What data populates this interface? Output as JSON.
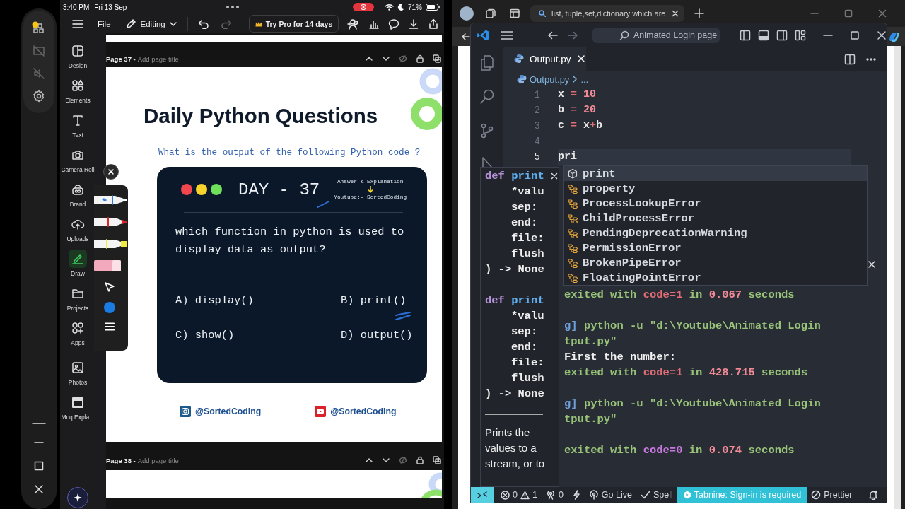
{
  "tablet": {
    "status_bar": {
      "time": "3:40 PM",
      "date": "Fri 13 Sep",
      "battery": "71%"
    },
    "toolbar": {
      "file": "File",
      "mode": "Editing",
      "promo": "Try Pro for 14 days"
    },
    "sidebar": {
      "tools": [
        {
          "label": "Design",
          "selected": false
        },
        {
          "label": "Elements",
          "selected": false
        },
        {
          "label": "Text",
          "selected": false
        },
        {
          "label": "Camera Roll",
          "selected": false
        },
        {
          "label": "Brand",
          "selected": false
        },
        {
          "label": "Uploads",
          "selected": false
        },
        {
          "label": "Draw",
          "selected": true
        },
        {
          "label": "Projects",
          "selected": false
        },
        {
          "label": "Apps",
          "selected": false
        }
      ],
      "folders": [
        {
          "label": "Photos",
          "selected": false
        },
        {
          "label": "Mcq Expla...",
          "selected": false
        }
      ]
    },
    "pages": [
      {
        "number": "Page 37 -",
        "title_placeholder": "Add page title"
      },
      {
        "number": "Page 38 -",
        "title_placeholder": "Add page title"
      }
    ],
    "slide": {
      "title": "Daily Python Questions",
      "subtitle": "What is the output of the following Python code ?",
      "card": {
        "day": "DAY - 37",
        "answer_label": "Answer & Explanation",
        "channel": "Youtube:- SortedCoding",
        "question": "which function in python is used to display data as output?",
        "options": [
          "A) display()",
          "B) print()",
          "C) show()",
          "D) output()"
        ]
      },
      "socials": [
        {
          "kind": "instagram",
          "handle": "@SortedCoding"
        },
        {
          "kind": "youtube",
          "handle": "@SortedCoding"
        }
      ]
    },
    "draw_palette": {
      "color": "#1a7be0"
    }
  },
  "browser": {
    "tab": {
      "title": "list, tuple,set,dictionary which are"
    }
  },
  "editor": {
    "command_center": "Animated Login page",
    "tabs": [
      {
        "label": "Output.py",
        "selected": true
      }
    ],
    "breadcrumb": [
      "Output.py",
      "..."
    ],
    "lines": [
      {
        "number": "1",
        "current": false,
        "tokens": [
          {
            "text": "x",
            "kind": "name"
          },
          {
            "text": " = ",
            "kind": "op"
          },
          {
            "text": "10",
            "kind": "num"
          }
        ]
      },
      {
        "number": "2",
        "current": false,
        "tokens": [
          {
            "text": "b",
            "kind": "name"
          },
          {
            "text": " = ",
            "kind": "op"
          },
          {
            "text": "20",
            "kind": "num"
          }
        ]
      },
      {
        "number": "3",
        "current": false,
        "tokens": [
          {
            "text": "c",
            "kind": "name"
          },
          {
            "text": " = ",
            "kind": "op"
          },
          {
            "text": "x",
            "kind": "name"
          },
          {
            "text": "+",
            "kind": "op"
          },
          {
            "text": "b",
            "kind": "name"
          }
        ]
      },
      {
        "number": "4",
        "current": false
      },
      {
        "number": "5",
        "current": true,
        "tokens": [
          {
            "text": "pri",
            "kind": "name"
          }
        ]
      }
    ],
    "suggestions": [
      {
        "label": "**pri**nt",
        "kind": "function",
        "selected": true
      },
      {
        "label": "**pr**operty",
        "kind": "class",
        "selected": false
      },
      {
        "label": "**Pr**ocessLookupError",
        "kind": "class",
        "selected": false
      },
      {
        "label": "Child**Pr**ocessError",
        "kind": "class",
        "selected": false
      },
      {
        "label": "**P**endingDep**r**ecationWarning",
        "kind": "class",
        "selected": false
      },
      {
        "label": "**P**ermissionE**r**ror",
        "kind": "class",
        "selected": false
      },
      {
        "label": "Broken**P**ipeE**r**ror",
        "kind": "class",
        "selected": false
      },
      {
        "label": "Floating**P**ointE**r**ror",
        "kind": "class",
        "selected": false
      }
    ],
    "hover": {
      "signatures": [
        {
          "keyword": "def",
          "name": "print",
          "params": [
            "*valu",
            "sep:",
            "end:",
            "file:",
            "flush"
          ],
          "returns": ") -> None"
        },
        {
          "keyword": "def",
          "name": "print",
          "params": [
            "*valu",
            "sep:",
            "end:",
            "file:",
            "flush"
          ],
          "returns": ") -> None"
        }
      ],
      "description": "Prints the values to a stream, or to"
    },
    "output": [
      [
        [
          {
            "text": "exited with ",
            "kind": "text"
          },
          {
            "text": "code=1",
            "kind": "err"
          },
          {
            "text": " in ",
            "kind": "text"
          },
          {
            "text": "0.067",
            "kind": "num"
          },
          {
            "text": " seconds",
            "kind": "text"
          }
        ]
      ],
      [
        [
          {
            "text": "g]",
            "kind": "tag"
          },
          {
            "text": " python -u \"d:\\Youtube\\Animated Login",
            "kind": "text"
          }
        ],
        [
          {
            "text": "tput.py\"",
            "kind": "text"
          }
        ],
        [
          {
            "text": "First the number:",
            "kind": "plain"
          }
        ],
        [
          {
            "text": "exited with ",
            "kind": "text"
          },
          {
            "text": "code=1",
            "kind": "err"
          },
          {
            "text": " in ",
            "kind": "text"
          },
          {
            "text": "428.715",
            "kind": "num"
          },
          {
            "text": " seconds",
            "kind": "text"
          }
        ]
      ],
      [
        [
          {
            "text": "g]",
            "kind": "tag"
          },
          {
            "text": " python -u \"d:\\Youtube\\Animated Login",
            "kind": "text"
          }
        ],
        [
          {
            "text": "tput.py\"",
            "kind": "text"
          }
        ]
      ],
      [
        [
          {
            "text": "exited with ",
            "kind": "text"
          },
          {
            "text": "code=0",
            "kind": "ok"
          },
          {
            "text": " in ",
            "kind": "text"
          },
          {
            "text": "0.074",
            "kind": "num"
          },
          {
            "text": " seconds",
            "kind": "text"
          }
        ]
      ]
    ],
    "status_bar": [
      {
        "kind": "remote"
      },
      {
        "kind": "problems",
        "errors": "0",
        "warnings": "1"
      },
      {
        "kind": "ports",
        "text": "0"
      },
      {
        "kind": "lightning"
      },
      {
        "kind": "golive",
        "text": "Go Live"
      },
      {
        "kind": "spell",
        "text": "Spell"
      },
      {
        "kind": "tabnine",
        "text": "Tabnine: Sign-in is required"
      },
      {
        "kind": "prettier",
        "text": "Prettier"
      },
      {
        "kind": "bell"
      }
    ]
  }
}
